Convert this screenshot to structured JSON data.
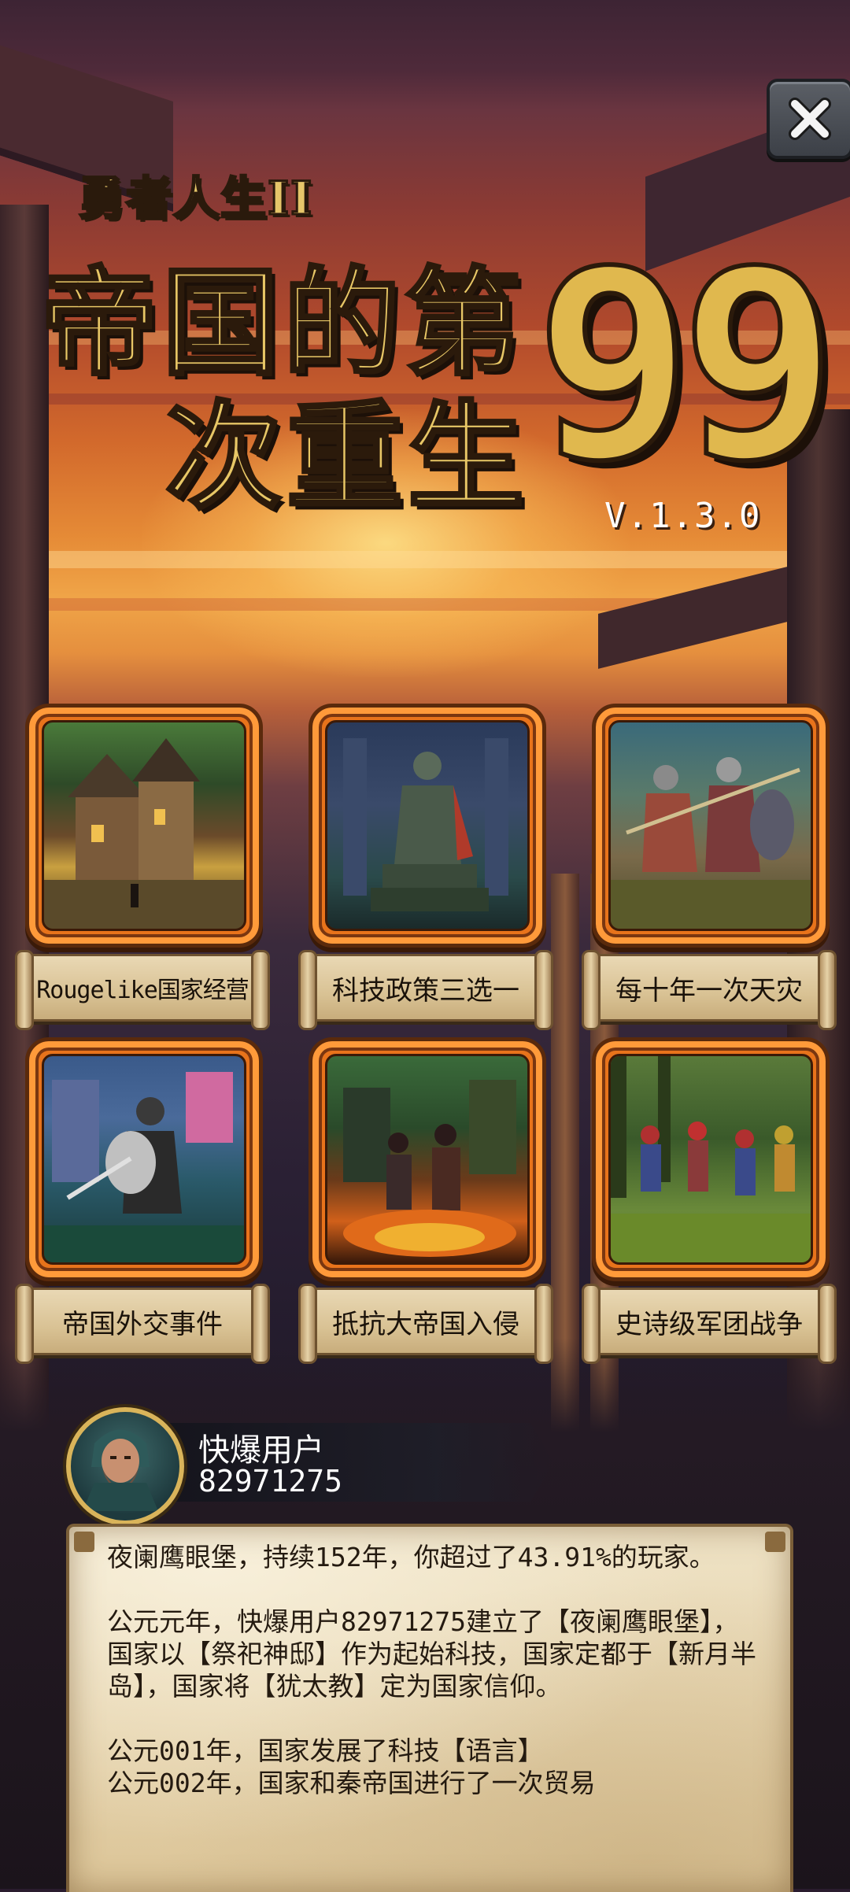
{
  "header": {
    "subtitle": "勇者人生II",
    "title_line1": "帝国的第",
    "title_line2": "次重生",
    "title_number": "99",
    "version": "V.1.3.0"
  },
  "close_button": {
    "icon": "close-icon"
  },
  "features": [
    {
      "label": "Rougelike国家经营",
      "art": "town-art"
    },
    {
      "label": "科技政策三选一",
      "art": "statue-art"
    },
    {
      "label": "每十年一次天灾",
      "art": "knights-battle-art"
    },
    {
      "label": "帝国外交事件",
      "art": "warrior-art"
    },
    {
      "label": "抵抗大帝国入侵",
      "art": "burning-city-art"
    },
    {
      "label": "史诗级军团战争",
      "art": "army-march-art"
    }
  ],
  "user": {
    "name": "快爆用户",
    "id": "82971275"
  },
  "log": {
    "summary": "夜阑鹰眼堡，持续152年，你超过了43.91%的玩家。",
    "founding": "公元元年，快爆用户82971275建立了【夜阑鹰眼堡】，国家以【祭祀神邸】作为起始科技，国家定都于【新月半岛】，国家将【犹太教】定为国家信仰。",
    "entry1": "公元001年，国家发展了科技【语言】",
    "entry2": "公元002年，国家和秦帝国进行了一次贸易"
  },
  "colors": {
    "title_gold": "#e8c766",
    "frame_orange": "#e8731b",
    "parchment": "#e6d4ae"
  }
}
